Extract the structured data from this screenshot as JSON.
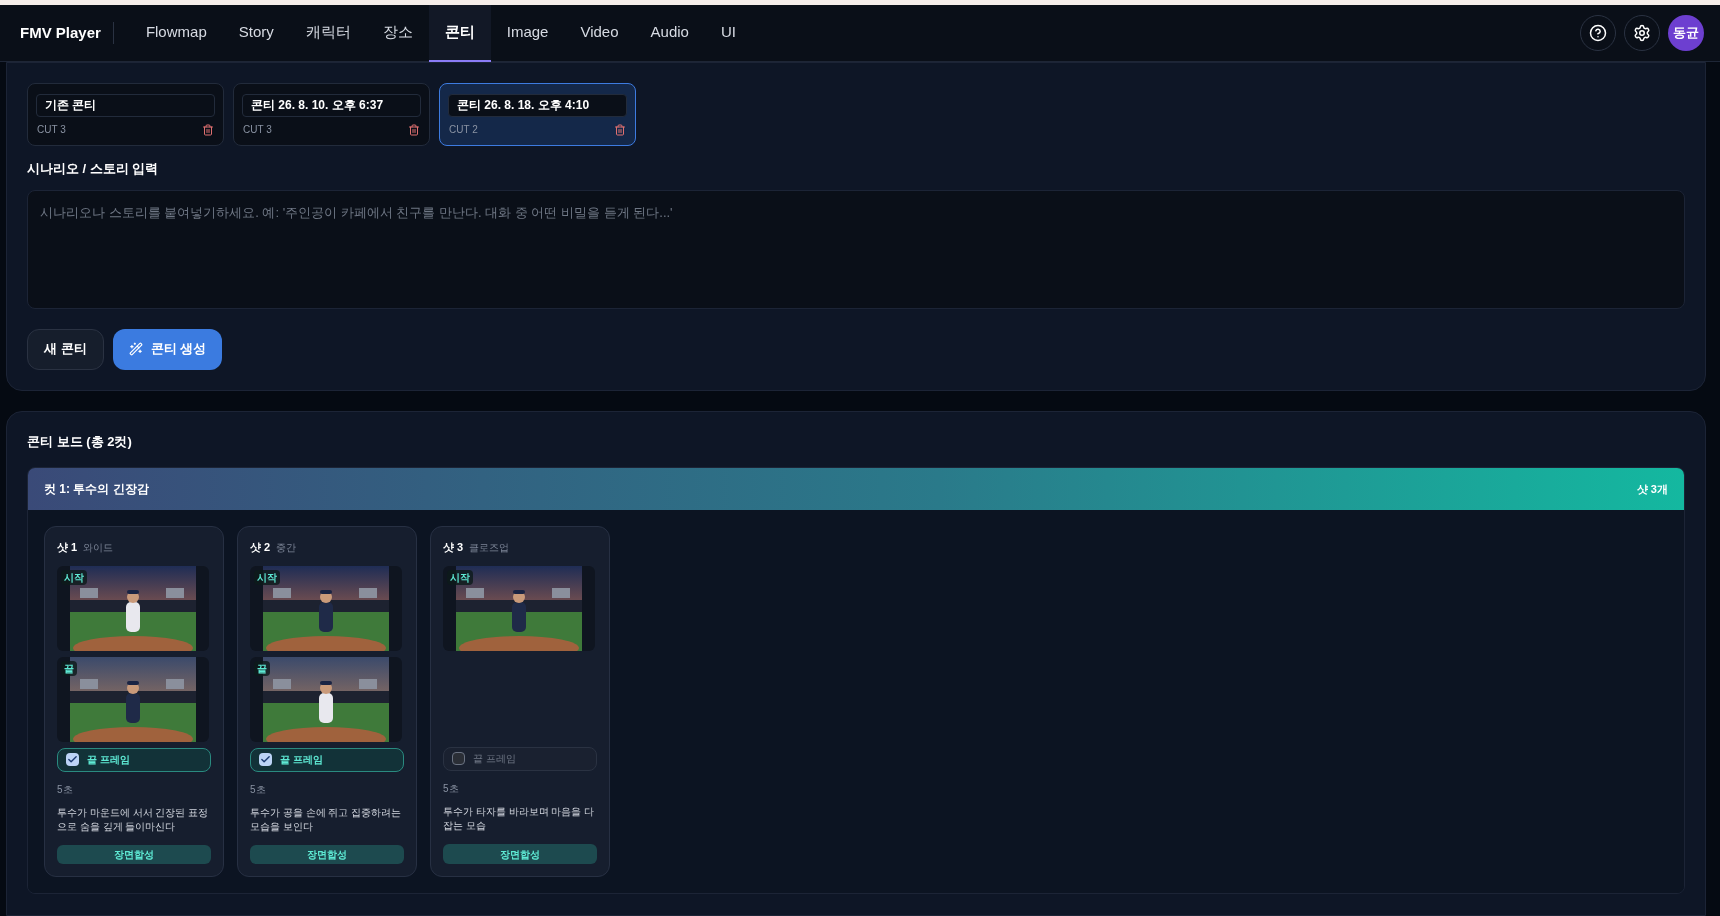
{
  "nav": {
    "brand": "FMV Player",
    "tabs": [
      {
        "label": "Flowmap",
        "selected": false
      },
      {
        "label": "Story",
        "selected": false
      },
      {
        "label": "캐릭터",
        "selected": false
      },
      {
        "label": "장소",
        "selected": false
      },
      {
        "label": "콘티",
        "selected": true
      },
      {
        "label": "Image",
        "selected": false
      },
      {
        "label": "Video",
        "selected": false
      },
      {
        "label": "Audio",
        "selected": false
      },
      {
        "label": "UI",
        "selected": false
      }
    ],
    "avatar": "동균"
  },
  "contis": [
    {
      "title": "기존 콘티",
      "cuts": "CUT 3",
      "selected": false
    },
    {
      "title": "콘티 26. 8. 10. 오후 6:37",
      "cuts": "CUT 3",
      "selected": false
    },
    {
      "title": "콘티 26. 8. 18. 오후 4:10",
      "cuts": "CUT 2",
      "selected": true
    }
  ],
  "scenario": {
    "label": "시나리오 / 스토리 입력",
    "placeholder": "시나리오나 스토리를 붙여넣기하세요. 예: '주인공이 카페에서 친구를 만난다. 대화 중 어떤 비밀을 듣게 된다...'"
  },
  "buttons": {
    "new": "새 콘티",
    "generate": "콘티 생성"
  },
  "board": {
    "title": "콘티 보드 (총 2컷)",
    "cut": {
      "title": "컷 1: 투수의 긴장감",
      "count": "샷 3개",
      "shots": [
        {
          "name": "샷 1",
          "type": "와이드",
          "frames": [
            {
              "badge": "시작",
              "kind": "picture"
            },
            {
              "badge": "끝",
              "kind": "picture"
            }
          ],
          "end_frame": {
            "label": "끝 프레임",
            "checked": true
          },
          "duration": "5초",
          "description": "투수가 마운드에 서서 긴장된 표정으로 숨을 깊게 들이마신다",
          "action": "장면합성"
        },
        {
          "name": "샷 2",
          "type": "중간",
          "frames": [
            {
              "badge": "시작",
              "kind": "picture"
            },
            {
              "badge": "끝",
              "kind": "picture"
            }
          ],
          "end_frame": {
            "label": "끝 프레임",
            "checked": true
          },
          "duration": "5초",
          "description": "투수가 공을 손에 쥐고 집중하려는 모습을 보인다",
          "action": "장면합성"
        },
        {
          "name": "샷 3",
          "type": "클로즈업",
          "frames": [
            {
              "badge": "시작",
              "kind": "picture"
            }
          ],
          "end_frame": {
            "label": "끝 프레임",
            "checked": false
          },
          "duration": "5초",
          "description": "투수가 타자를 바라보며 마음을 다잡는 모습",
          "action": "장면합성"
        }
      ]
    }
  }
}
